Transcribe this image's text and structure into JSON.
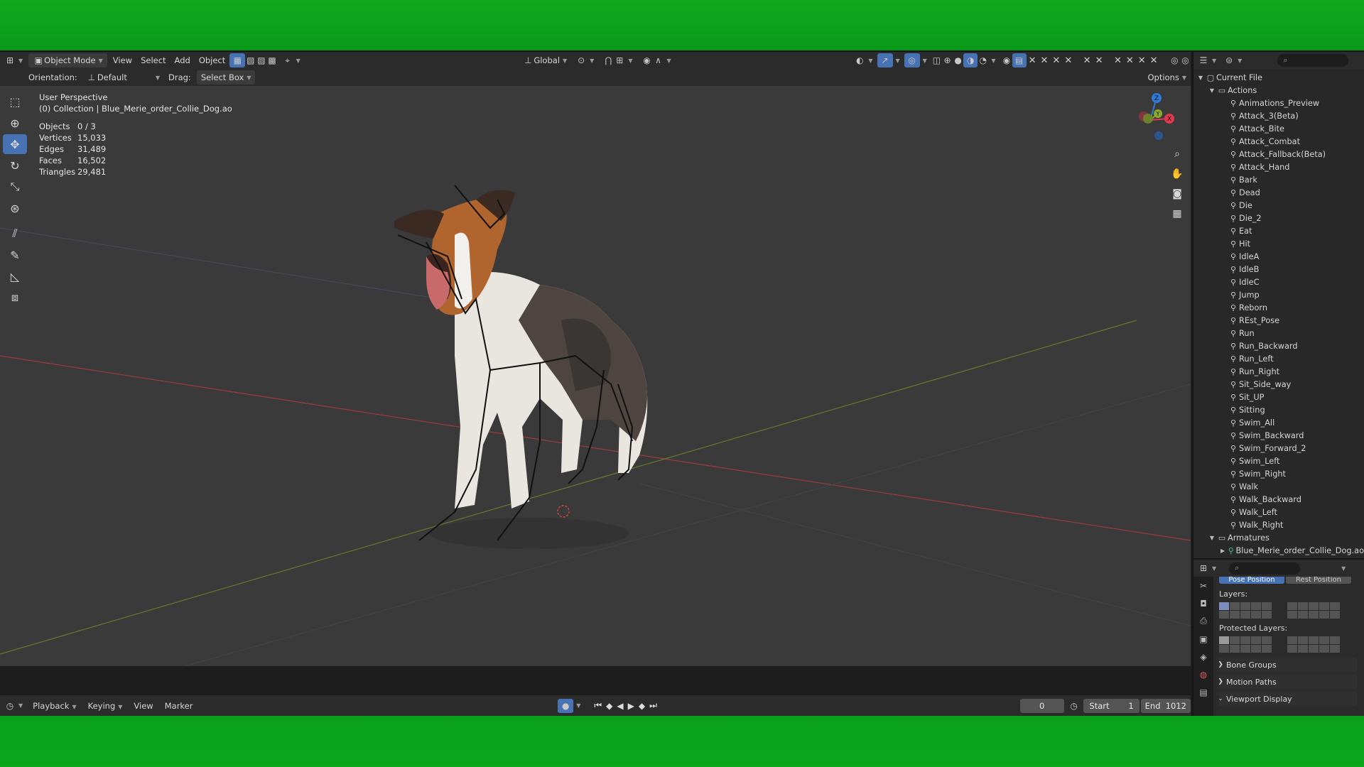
{
  "header": {
    "mode": "Object Mode",
    "menus": [
      "View",
      "Select",
      "Add",
      "Object"
    ],
    "transform_orientation": "Global"
  },
  "tool_header": {
    "orientation_label": "Orientation:",
    "orientation_value": "Default",
    "drag_label": "Drag:",
    "drag_value": "Select Box",
    "options_label": "Options"
  },
  "viewport": {
    "view_name": "User Perspective",
    "collection": "(0) Collection | Blue_Merie_order_Collie_Dog.ao",
    "stats": [
      {
        "key": "Objects",
        "value": "0 / 3"
      },
      {
        "key": "Vertices",
        "value": "15,033"
      },
      {
        "key": "Edges",
        "value": "31,489"
      },
      {
        "key": "Faces",
        "value": "16,502"
      },
      {
        "key": "Triangles",
        "value": "29,481"
      }
    ],
    "gizmo_axes": [
      "Z",
      "Y",
      "X"
    ]
  },
  "timeline": {
    "menus": [
      "Playback",
      "Keying",
      "View",
      "Marker"
    ],
    "current_frame": "0",
    "start_label": "Start",
    "start_value": "1",
    "end_label": "End",
    "end_value": "1012"
  },
  "outliner": {
    "root": "Current File",
    "actions_label": "Actions",
    "actions": [
      "Animations_Preview",
      "Attack_3(Beta)",
      "Attack_Bite",
      "Attack_Combat",
      "Attack_Fallback(Beta)",
      "Attack_Hand",
      "Bark",
      "Dead",
      "Die",
      "Die_2",
      "Eat",
      "Hit",
      "IdleA",
      "IdleB",
      "IdleC",
      "Jump",
      "Reborn",
      "REst_Pose",
      "Run",
      "Run_Backward",
      "Run_Left",
      "Run_Right",
      "Sit_Side_way",
      "Sit_UP",
      "Sitting",
      "Swim_All",
      "Swim_Backward",
      "Swim_Forward_2",
      "Swim_Left",
      "Swim_Right",
      "Walk",
      "Walk_Backward",
      "Walk_Left",
      "Walk_Right"
    ],
    "armatures_label": "Armatures",
    "armature_item": "Blue_Merie_order_Collie_Dog.ao"
  },
  "properties": {
    "pose_position": "Pose Position",
    "rest_position": "Rest Position",
    "layers_label": "Layers:",
    "protected_layers_label": "Protected Layers:",
    "panels": [
      "Bone Groups",
      "Motion Paths",
      "Viewport Display"
    ]
  },
  "colors": {
    "accent": "#4772b3",
    "background_green": "#0ca51c",
    "viewport_bg": "#3a3a3a",
    "x_axis": "#e2384f",
    "y_axis": "#8aac2d",
    "z_axis": "#2e7ad6"
  }
}
